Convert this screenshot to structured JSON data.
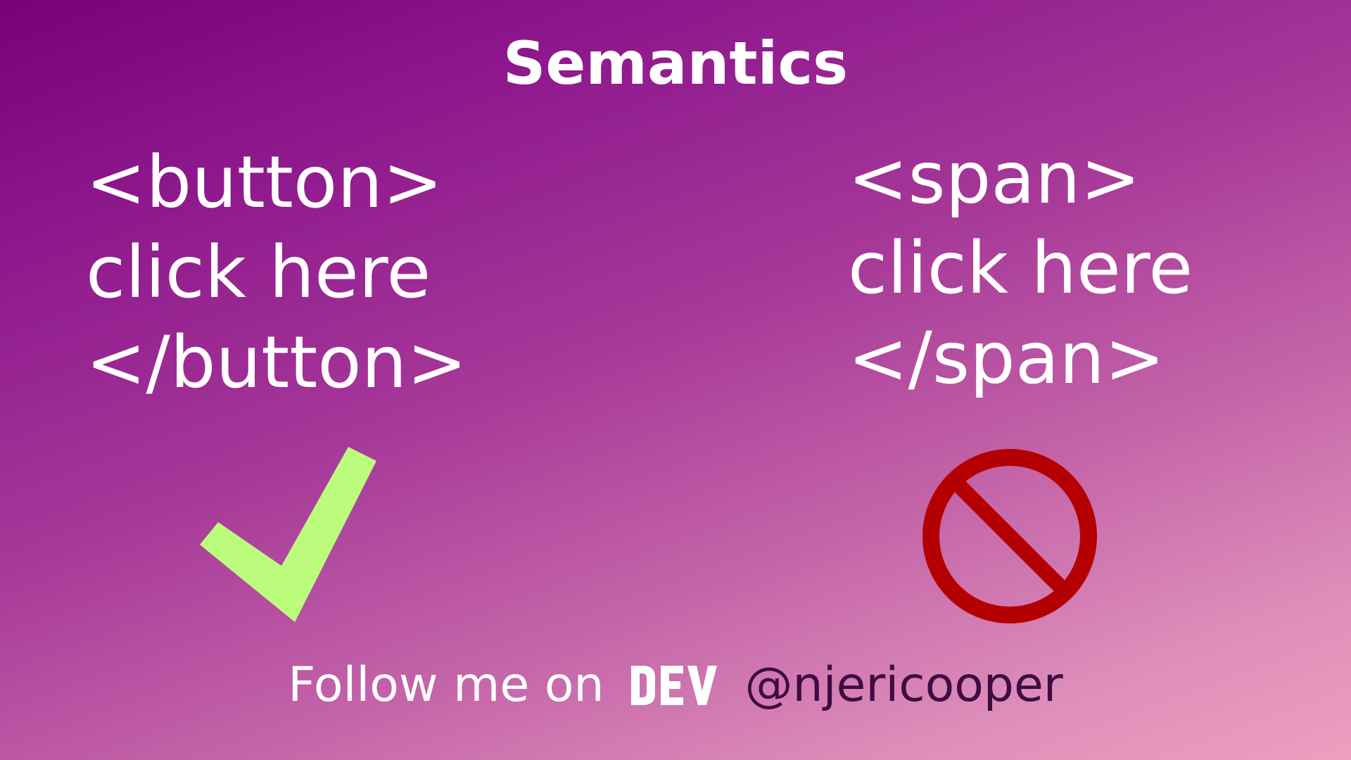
{
  "title": "Semantics",
  "left_example": {
    "lines": [
      "<button>",
      "click here",
      "</button>"
    ]
  },
  "right_example": {
    "lines": [
      "<span>",
      "click here",
      "</span>"
    ]
  },
  "icons": {
    "left": "check-icon",
    "right": "no-icon"
  },
  "footer": {
    "text": "Follow me on",
    "logo": "DEV",
    "handle": "@njericooper"
  },
  "colors": {
    "background_start": "#7a0078",
    "background_end": "#ec9fbf",
    "check": "#bcfc7d",
    "no": "#b40000",
    "handle": "#3e0b42"
  }
}
